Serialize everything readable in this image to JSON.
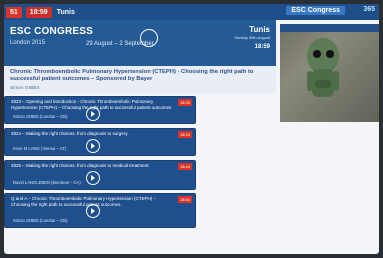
{
  "topbar": {
    "count": "51",
    "time": "18:59",
    "city": "Tunis",
    "brand": "ESC Congress",
    "brand_number": "365"
  },
  "header": {
    "logo": "ESC CONGRESS",
    "subtitle": "London 2015",
    "dates": "29 August – 2 September",
    "city": "Tunis",
    "date_line": "Sunday 30th August",
    "room": "18:59"
  },
  "session": {
    "title": "Chronic Thromboembolic Pulmonary Hypertension (CTEPH) - Choosing the right path to successful patient outcomes – Sponsored by Bayer",
    "chairs": "Simon GIBBS"
  },
  "talks": [
    {
      "label": "4823 – Opening and introduction - Chronic Thromboembolic Pulmonary Hypertension (CTEPH) – Choosing the right path to successful patient outcomes",
      "speaker": "Simon GIBBS (London – GB)",
      "time": "18:30"
    },
    {
      "label": "4824 – Making the right choices: from diagnosis to surgery.",
      "speaker": "Irene M LANG (Vienna – AT)",
      "time": "18:34"
    },
    {
      "label": "4825 – Making the right choices: from diagnosis to medical treatment.",
      "speaker": "David LANGLEBEN (Montreal – CA)",
      "time": "18:44"
    },
    {
      "label": "Q and A – Chronic Thromboembolic Pulmonary Hypertension (CTEPH) – Choosing the right path to successful patient outcomes.",
      "speaker": "Simon GIBBS (London – GB)",
      "time": "18:54"
    }
  ]
}
